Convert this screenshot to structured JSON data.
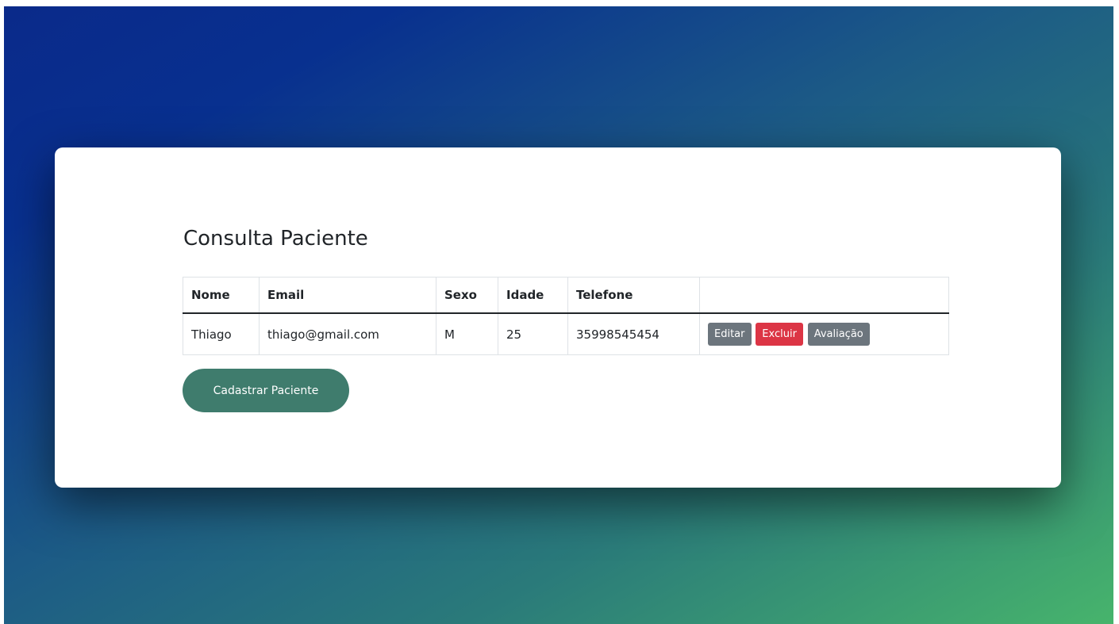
{
  "page": {
    "title": "Consulta Paciente"
  },
  "table": {
    "headers": {
      "nome": "Nome",
      "email": "Email",
      "sexo": "Sexo",
      "idade": "Idade",
      "telefone": "Telefone",
      "acoes": ""
    },
    "rows": [
      {
        "nome": "Thiago",
        "email": "thiago@gmail.com",
        "sexo": "M",
        "idade": "25",
        "telefone": "35998545454",
        "actions": {
          "edit_label": "Editar",
          "delete_label": "Excluir",
          "evaluation_label": "Avaliação"
        }
      }
    ]
  },
  "actions": {
    "register_label": "Cadastrar Paciente"
  },
  "colors": {
    "secondary": "#6c757d",
    "danger": "#dc3545",
    "primary_action": "#3f7c6d",
    "background_start": "#0a2a8a",
    "background_end": "#47b46c"
  }
}
